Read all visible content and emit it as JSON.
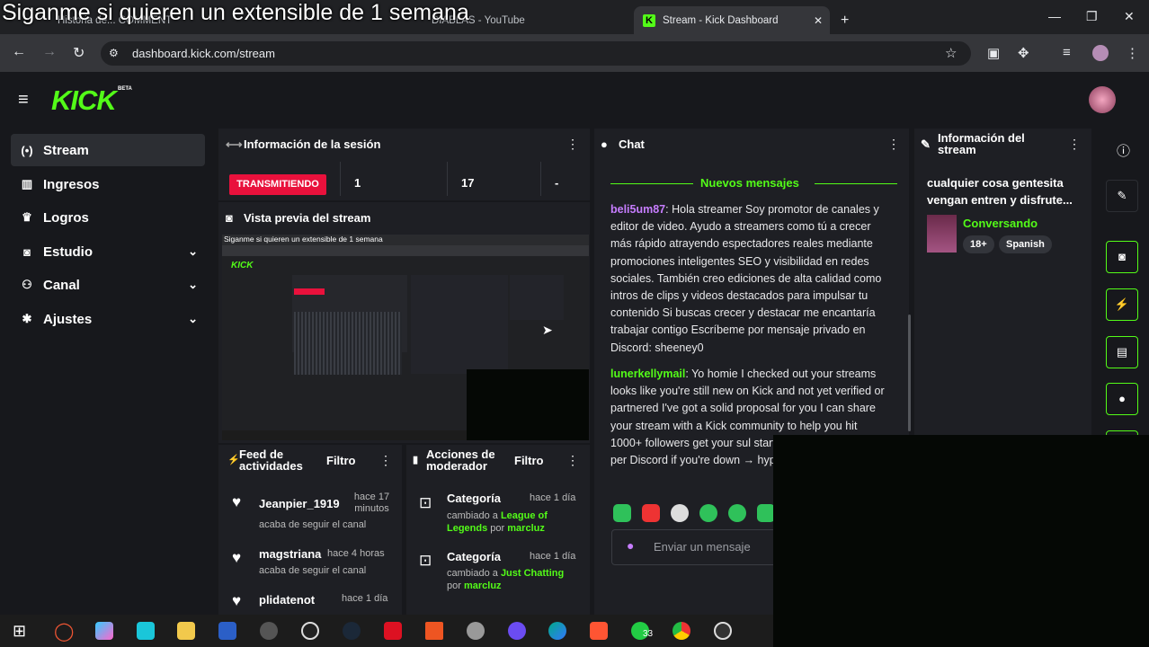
{
  "overlay_caption": "Siganme si quieren un extensible de 1 semana",
  "browser": {
    "tabs": [
      {
        "label": "Historia de... COMMENT"
      },
      {
        "label": "DIABLAS - YouTube"
      },
      {
        "label": "Stream - Kick Dashboard"
      }
    ],
    "new_tab": "+",
    "url": "dashboard.kick.com/stream"
  },
  "brand": {
    "logo": "KICK",
    "beta": "BETA",
    "accent": "#53fc18"
  },
  "sidebar": [
    {
      "label": "Stream",
      "icon": "broadcast-icon"
    },
    {
      "label": "Ingresos",
      "icon": "chart-icon"
    },
    {
      "label": "Logros",
      "icon": "trophy-icon"
    },
    {
      "label": "Estudio",
      "icon": "studio-icon"
    },
    {
      "label": "Canal",
      "icon": "people-icon"
    },
    {
      "label": "Ajustes",
      "icon": "gear-icon"
    }
  ],
  "session": {
    "title": "Información de la sesión",
    "status": "TRANSMITIENDO",
    "stat1": "1",
    "stat2": "17",
    "stat3": "-"
  },
  "preview": {
    "title": "Vista previa del stream",
    "inner_caption": "Siganme si quieren un extensible de 1 semana"
  },
  "feed": {
    "title": "Feed de actividades",
    "filter": "Filtro",
    "items": [
      {
        "user": "Jeanpier_1919",
        "time": "hace 17 minutos",
        "action": "acaba de seguir el canal"
      },
      {
        "user": "magstriana",
        "time": "hace 4 horas",
        "action": "acaba de seguir el canal"
      },
      {
        "user": "plidatenot",
        "time": "hace 1 día"
      }
    ]
  },
  "mod": {
    "title": "Acciones de moderador",
    "filter": "Filtro",
    "items": [
      {
        "title": "Categoría",
        "time": "hace 1 día",
        "pre": "cambiado a",
        "value": "League of Legends",
        "by": "por",
        "user": "marcluz"
      },
      {
        "title": "Categoría",
        "time": "hace 1 día",
        "pre": "cambiado a",
        "value": "Just Chatting",
        "by": "por",
        "user": "marcluz"
      }
    ]
  },
  "chat": {
    "title": "Chat",
    "new_messages": "Nuevos mensajes",
    "messages": [
      {
        "user": "beli5um87",
        "text": ": Hola streamer Soy promotor de canales y editor de video. Ayudo a streamers como tú a crecer más rápido atrayendo espectadores reales mediante promociones inteligentes SEO y visibilidad en redes sociales. También creo ediciones de alta calidad como intros de clips y videos destacados para impulsar tu contenido Si buscas crecer y destacar me encantaría trabajar contigo Escríbeme por mensaje privado en Discord: sheeney0"
      },
      {
        "user": "lunerkellymail",
        "text": ": Yo homie I checked out your streams looks like you're still new on Kick and not yet verified or partnered I've got a solid proposal for you I can share your stream with a Kick community to help you hit 1000+ followers get your sul start earning 1000 or more per Discord if you're down → hyper"
      }
    ],
    "input_placeholder": "Enviar un mensaje"
  },
  "stream_info": {
    "title": "Información del stream",
    "stream_title": "cualquier cosa gentesita vengan entren y disfrute...",
    "category": "Conversando",
    "tags": [
      "18+",
      "Spanish"
    ]
  },
  "taskbar": {
    "badge": "33"
  }
}
